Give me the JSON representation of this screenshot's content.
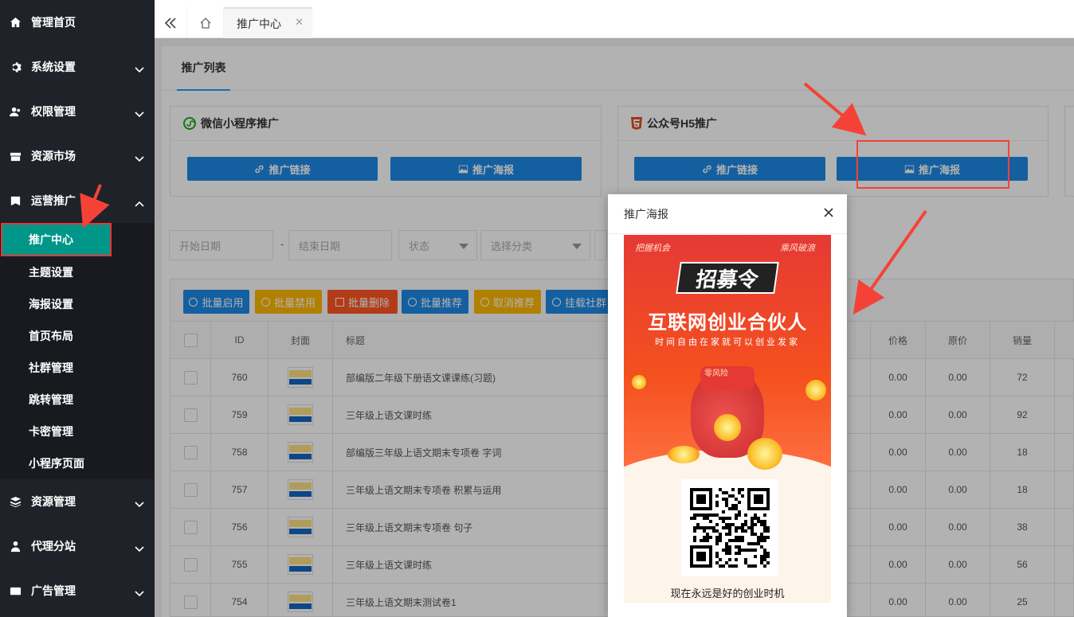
{
  "sidebar": {
    "menus": [
      {
        "label": "管理首页",
        "icon": "home-icon"
      },
      {
        "label": "系统设置",
        "icon": "gear-icon"
      },
      {
        "label": "权限管理",
        "icon": "users-icon"
      },
      {
        "label": "资源市场",
        "icon": "store-icon"
      },
      {
        "label": "运营推广",
        "icon": "flag-icon"
      }
    ],
    "sub": [
      "推广中心",
      "主题设置",
      "海报设置",
      "首页布局",
      "社群管理",
      "跳转管理",
      "卡密管理",
      "小程序页面"
    ],
    "menus2": [
      {
        "label": "资源管理",
        "icon": "layers-icon"
      },
      {
        "label": "代理分站",
        "icon": "agent-icon"
      },
      {
        "label": "广告管理",
        "icon": "ad-icon"
      }
    ]
  },
  "topbar": {
    "tab": "推广中心"
  },
  "tabs": {
    "active": "推广列表"
  },
  "cards": {
    "wechat": {
      "title": "微信小程序推广",
      "link": "推广链接",
      "poster": "推广海报"
    },
    "h5": {
      "title": "公众号H5推广",
      "link": "推广链接",
      "poster": "推广海报"
    }
  },
  "filters": {
    "start": "开始日期",
    "end": "结束日期",
    "status": "状态",
    "category": "选择分类",
    "dash": "-"
  },
  "toolbar": [
    "批量启用",
    "批量禁用",
    "批量删除",
    "批量推荐",
    "取消推荐",
    "挂载社群"
  ],
  "table": {
    "headers": {
      "id": "ID",
      "cover": "封面",
      "title": "标题",
      "price": "价格",
      "orig": "原价",
      "sales": "销量"
    },
    "rows": [
      {
        "id": "760",
        "title": "部编版二年级下册语文课课练(习题)",
        "price": "0.00",
        "orig": "0.00",
        "sales": "72"
      },
      {
        "id": "759",
        "title": "三年级上语文课时练",
        "price": "0.00",
        "orig": "0.00",
        "sales": "92"
      },
      {
        "id": "758",
        "title": "部编版三年级上语文期末专项卷 字词",
        "price": "0.00",
        "orig": "0.00",
        "sales": "18"
      },
      {
        "id": "757",
        "title": "三年级上语文期末专项卷 积累与运用",
        "price": "0.00",
        "orig": "0.00",
        "sales": "18"
      },
      {
        "id": "756",
        "title": "三年级上语文期末专项卷 句子",
        "price": "0.00",
        "orig": "0.00",
        "sales": "38"
      },
      {
        "id": "755",
        "title": "三年级上语文课时练",
        "price": "0.00",
        "orig": "0.00",
        "sales": "56"
      },
      {
        "id": "754",
        "title": "三年级上语文期末测试卷1",
        "price": "0.00",
        "orig": "0.00",
        "sales": "25"
      }
    ]
  },
  "modal": {
    "title": "推广海报",
    "poster": {
      "tl": "把握机会",
      "tr": "乘风破浪",
      "badge": "招募令",
      "headline": "互联网创业合伙人",
      "sub": "时间自由在家就可以创业发家",
      "bagtag": "零风险",
      "caption": "现在永远是好的创业时机"
    }
  },
  "colors": {
    "accent": "#009688",
    "primary": "#1e88e5",
    "warning": "#ffb800",
    "danger": "#ff5722",
    "arrow": "#f44336"
  }
}
